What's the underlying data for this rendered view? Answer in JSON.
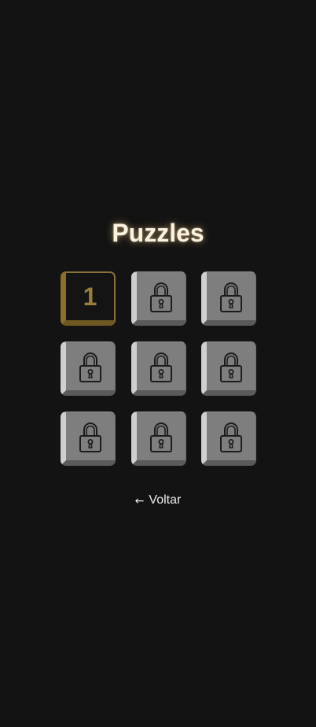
{
  "title": "Puzzles",
  "levels": [
    {
      "label": "1",
      "locked": false
    },
    {
      "label": "",
      "locked": true
    },
    {
      "label": "",
      "locked": true
    },
    {
      "label": "",
      "locked": true
    },
    {
      "label": "",
      "locked": true
    },
    {
      "label": "",
      "locked": true
    },
    {
      "label": "",
      "locked": true
    },
    {
      "label": "",
      "locked": true
    },
    {
      "label": "",
      "locked": true
    }
  ],
  "back": {
    "arrow": "←",
    "label": "Voltar"
  },
  "colors": {
    "background": "#131313",
    "title": "#fbf3e1",
    "locked_tile": "#7e7e7e",
    "unlocked_accent": "#9a7d39"
  },
  "icons": {
    "locked": "padlock-icon",
    "back": "left-arrow-icon"
  }
}
